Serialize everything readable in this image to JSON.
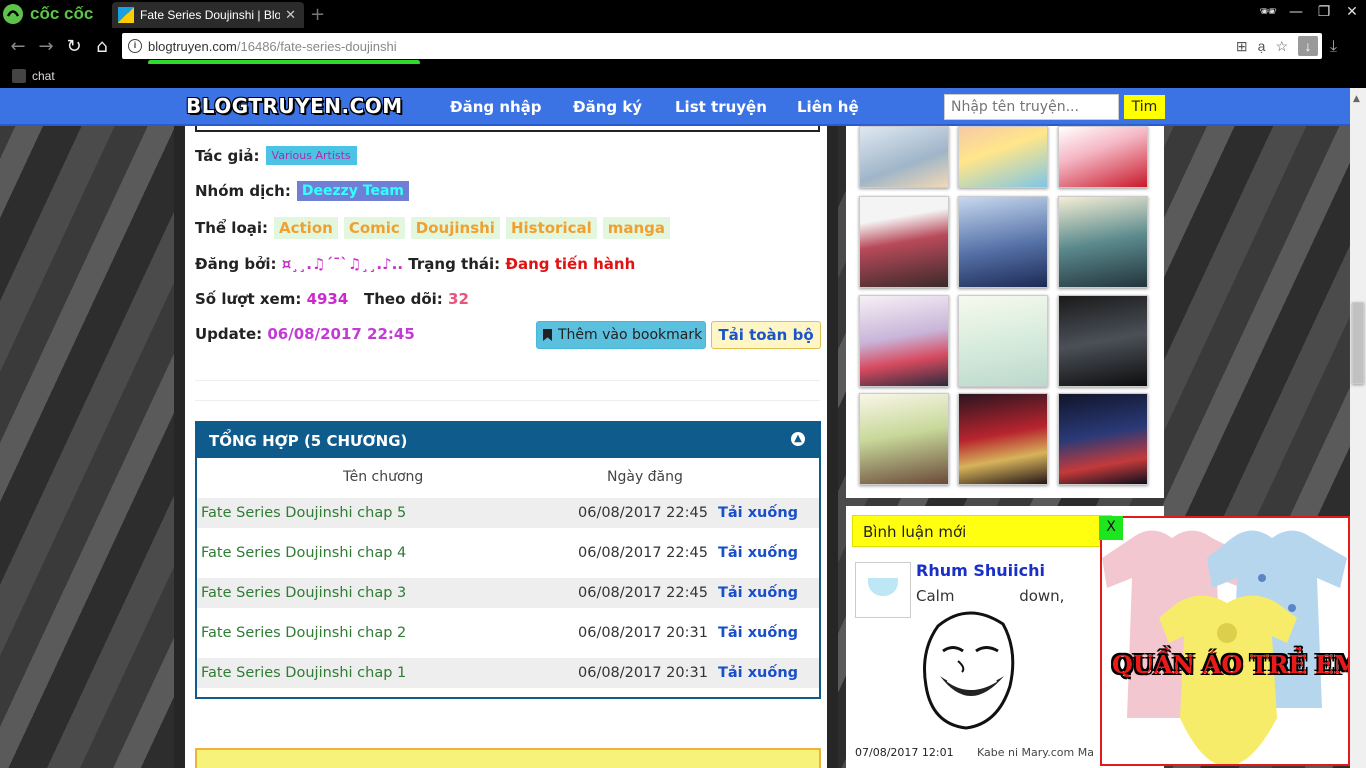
{
  "browser": {
    "brand": "cốc cốc",
    "tab_title": "Fate Series Doujinshi | Blog",
    "url_host": "blogtruyen.com",
    "url_path": "/16486/fate-series-doujinshi",
    "bookmark": "chat",
    "window_controls": [
      "—",
      "❐",
      "✕"
    ]
  },
  "site": {
    "logo": "BLOGTRUYEN.COM",
    "nav": [
      "Đăng nhập",
      "Đăng ký",
      "List truyện",
      "Liên hệ"
    ],
    "search_placeholder": "Nhập tên truyện...",
    "search_button": "Tim"
  },
  "info": {
    "author_label": "Tác giả:",
    "author": "Various Artists",
    "team_label": "Nhóm dịch:",
    "team": "Deezzy Team",
    "genre_label": "Thể loại:",
    "genres": [
      "Action",
      "Comic",
      "Doujinshi",
      "Historical",
      "manga"
    ],
    "posted_label": "Đăng bởi:",
    "posted_by": "¤¸¸.♫´¯`♫¸¸.♪..",
    "status_label": "Trạng thái:",
    "status": "Đang tiến hành",
    "views_label": "Số lượt xem:",
    "views": "4934",
    "follow_label": "Theo dõi:",
    "follow": "32",
    "update_label": "Update:",
    "update": "06/08/2017 22:45",
    "bookmark_button": "Thêm vào bookmark",
    "download_all": "Tải toàn bộ"
  },
  "chapters": {
    "heading": "TỔNG HỢP (5 CHƯƠNG)",
    "col_name": "Tên chương",
    "col_date": "Ngày đăng",
    "rows": [
      {
        "name": "Fate Series Doujinshi chap 5",
        "date": "06/08/2017 22:45",
        "dl": "Tải xuống"
      },
      {
        "name": "Fate Series Doujinshi chap 4",
        "date": "06/08/2017 22:45",
        "dl": "Tải xuống"
      },
      {
        "name": "Fate Series Doujinshi chap 3",
        "date": "06/08/2017 22:45",
        "dl": "Tải xuống"
      },
      {
        "name": "Fate Series Doujinshi chap 2",
        "date": "06/08/2017 20:31",
        "dl": "Tải xuống"
      },
      {
        "name": "Fate Series Doujinshi chap 1",
        "date": "06/08/2017 20:31",
        "dl": "Tải xuống"
      }
    ]
  },
  "comments": {
    "heading": "Bình luận mới",
    "user": "Rhum Shuiichi",
    "text": "Calm down,",
    "date": "07/08/2017 12:01",
    "by": "Kabe ni Mary.com Ma"
  },
  "ad": {
    "close": "X",
    "text": "QUẦN ÁO TRẺ EM"
  },
  "colors": {
    "site_bar": "#3b73e5",
    "chapter_header": "#0f5c8c",
    "chapter_link": "#2e7d32",
    "download_link": "#1a4fc8"
  }
}
